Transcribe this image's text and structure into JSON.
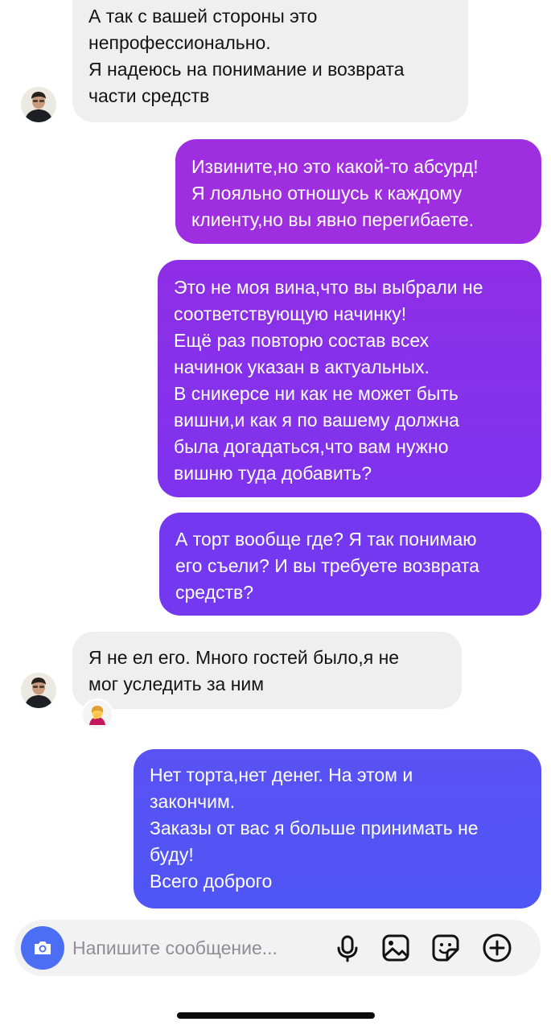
{
  "messages": [
    {
      "direction": "incoming",
      "lines": [
        "А так с вашей стороны это",
        "непрофессионально.",
        "Я надеюсь на понимание и возврата",
        "части средств"
      ]
    },
    {
      "direction": "outgoing",
      "lines": [
        "Извините,но это какой-то абсурд!",
        "Я лояльно отношусь к каждому",
        "клиенту,но вы явно перегибаете."
      ]
    },
    {
      "direction": "outgoing",
      "lines": [
        "Это не моя вина,что вы выбрали не",
        "соответствующую начинку!",
        "Ещё раз повторю состав всех",
        "начинок указан в актуальных.",
        "В сникерсе ни как не может быть",
        "вишни,и как я по вашему должна",
        "была догадаться,что вам нужно",
        "вишню туда добавить?"
      ]
    },
    {
      "direction": "outgoing",
      "lines": [
        "А торт вообще где? Я так понимаю",
        "его съели? И вы требуете возврата",
        "средств?"
      ]
    },
    {
      "direction": "incoming",
      "lines": [
        "Я не ел его. Много гостей было,я не",
        "мог уследить за ним"
      ],
      "reaction": "woman-facepalming-emoji"
    },
    {
      "direction": "outgoing",
      "lines": [
        "Нет торта,нет денег. На этом и",
        "закончим.",
        "Заказы от вас я больше принимать не",
        "буду!",
        "Всего доброго"
      ]
    }
  ],
  "composer": {
    "placeholder": "Напишите сообщение...",
    "icons": [
      "camera-icon",
      "microphone-icon",
      "gallery-icon",
      "sticker-icon",
      "plus-icon"
    ]
  },
  "colors": {
    "incoming_bubble": "#efeff0",
    "outgoing_gradient_top": "#a42fe0",
    "outgoing_gradient_bottom": "#4f55f5",
    "camera_button": "#4c6ef5"
  }
}
